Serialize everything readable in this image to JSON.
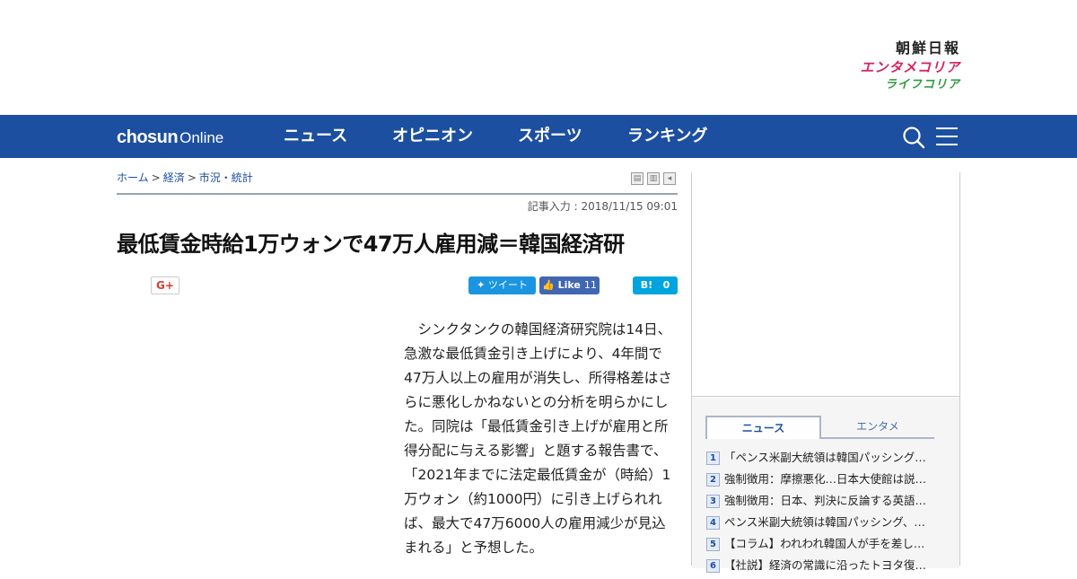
{
  "brand": {
    "chosun": "朝鮮日報",
    "entame": "エンタメコリア",
    "life": "ライフコリア"
  },
  "nav": {
    "logo_bold": "chosun",
    "logo_light": "Online",
    "items": [
      "ニュース",
      "オピニオン",
      "スポーツ",
      "ランキング"
    ],
    "search_icon": "search-icon",
    "menu_icon": "hamburger-menu-icon"
  },
  "breadcrumb": {
    "home": "ホーム",
    "sep": ">",
    "category": "経済",
    "subcategory": "市況・統計"
  },
  "article": {
    "date": "記事入力 : 2018/11/15 09:01",
    "headline": "最低賃金時給1万ウォンで47万人雇用減＝韓国経済研",
    "body": "　シンクタンクの韓国経済研究院は14日、急激な最低賃金引き上げにより、4年間で47万人以上の雇用が消失し、所得格差はさらに悪化しかねないとの分析を明らかにした。同院は「最低賃金引き上げが雇用と所得分配に与える影響」と題する報告書で、「2021年までに法定最低賃金が（時給）1万ウォン（約1000円）に引き上げられれば、最大で47万6000人の雇用減少が見込まれる」と予想した。"
  },
  "share": {
    "gplus": "G+",
    "tweet": "ツイート",
    "like": "Like",
    "like_count": "11",
    "hatena": "B!",
    "hatena_count": "0"
  },
  "sidebar": {
    "tabs": [
      "ニュース",
      "エンタメ"
    ],
    "ranking": [
      {
        "num": "1",
        "title": "「ペンス米副大統領は韓国パッシング…"
      },
      {
        "num": "2",
        "title": "強制徴用：摩擦悪化…日本大使館は説…"
      },
      {
        "num": "3",
        "title": "強制徴用：日本、判決に反論する英語…"
      },
      {
        "num": "4",
        "title": "ペンス米副大統領は韓国パッシング、…"
      },
      {
        "num": "5",
        "title": "【コラム】われわれ韓国人が手を差し…"
      },
      {
        "num": "6",
        "title": "【社説】経済の常識に沿ったトヨタ復…"
      }
    ]
  },
  "colors": {
    "nav_bg": "#1c4fa0",
    "entame": "#d6245c",
    "life": "#2e9b3e",
    "twitter": "#1b95e0",
    "facebook": "#4267b2",
    "hatena": "#00a4de"
  }
}
